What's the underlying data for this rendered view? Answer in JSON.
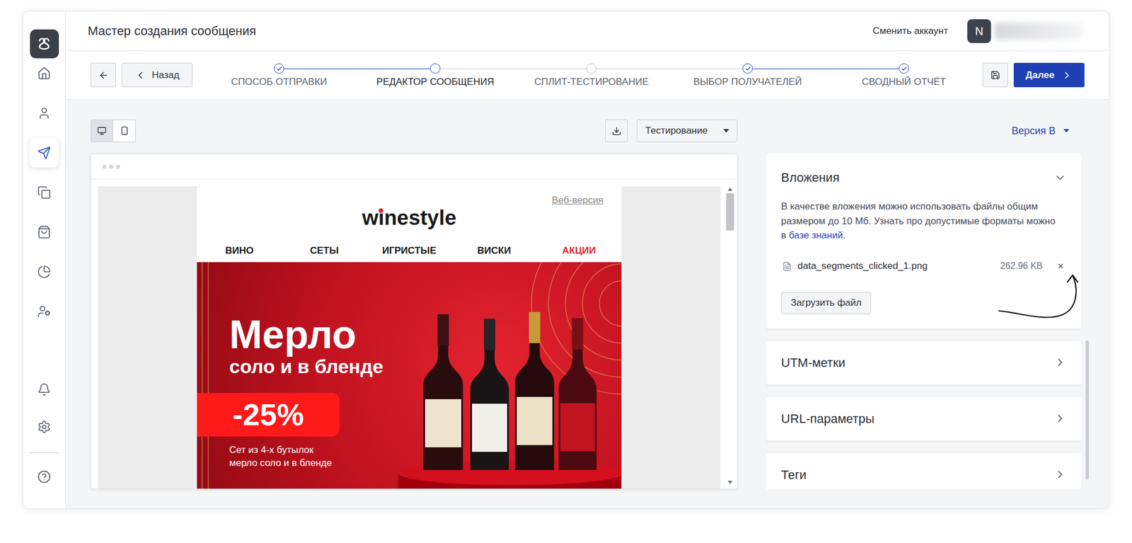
{
  "app": {
    "title": "Мастер создания сообщения",
    "switch_account": "Сменить аккаунт",
    "avatar": "N"
  },
  "sidebar": {
    "items": [
      {
        "selected": false
      },
      {
        "selected": false
      },
      {
        "selected": true
      },
      {
        "selected": false
      },
      {
        "selected": false
      },
      {
        "selected": false
      },
      {
        "selected": false
      }
    ],
    "bottom_items": [
      {
        "selected": false
      },
      {
        "selected": false
      },
      {
        "selected": false
      }
    ]
  },
  "wizard": {
    "back": "Назад",
    "next": "Далее",
    "steps": [
      {
        "label": "СПОСОБ ОТПРАВКИ",
        "completed": true,
        "selected": false
      },
      {
        "label": "РЕДАКТОР СООБЩЕНИЯ",
        "completed": false,
        "selected": true
      },
      {
        "label": "СПЛИТ-ТЕСТИРОВАНИЕ",
        "completed": false,
        "selected": false
      },
      {
        "label": "ВЫБОР ПОЛУЧАТЕЛЕЙ",
        "completed": true,
        "selected": false
      },
      {
        "label": "СВОДНЫЙ ОТЧЁТ",
        "completed": true,
        "selected": false
      }
    ]
  },
  "toolbar": {
    "views": [
      {
        "selected": true
      },
      {
        "selected": false
      }
    ],
    "mode": "Тестирование",
    "version": "Версия B"
  },
  "email": {
    "web_version": "Веб-версия",
    "logo": {
      "before": "w",
      "mark": "ı",
      "after": "nestyle"
    },
    "nav": [
      {
        "label": "ВИНО",
        "color": "#1a1a1a"
      },
      {
        "label": "СЕТЫ",
        "color": "#1a1a1a"
      },
      {
        "label": "ИГРИСТЫЕ",
        "color": "#1a1a1a"
      },
      {
        "label": "ВИСКИ",
        "color": "#1a1a1a"
      },
      {
        "label": "АКЦИИ",
        "color": "#e3262b"
      }
    ],
    "banner": {
      "title": "Мерло",
      "subtitle": "соло и в бленде",
      "discount": "-25%",
      "caption": [
        "Сет из 4-х бутылок",
        "мерло соло и в бленде"
      ]
    }
  },
  "attachments": {
    "title": "Вложения",
    "expanded": true,
    "description": "В качестве вложения можно использовать файлы общим размером до 10 Мб. Узнать про допустимые форматы можно в ",
    "link": "базе знаний",
    "description_end": ".",
    "files": [
      {
        "name": "data_segments_clicked_1.png",
        "size": "262.96 KB",
        "remove": "×"
      }
    ],
    "upload": "Загрузить файл"
  },
  "sections": [
    {
      "title": "UTM-метки",
      "expanded": false
    },
    {
      "title": "URL-параметры",
      "expanded": false
    },
    {
      "title": "Теги",
      "expanded": false
    }
  ]
}
